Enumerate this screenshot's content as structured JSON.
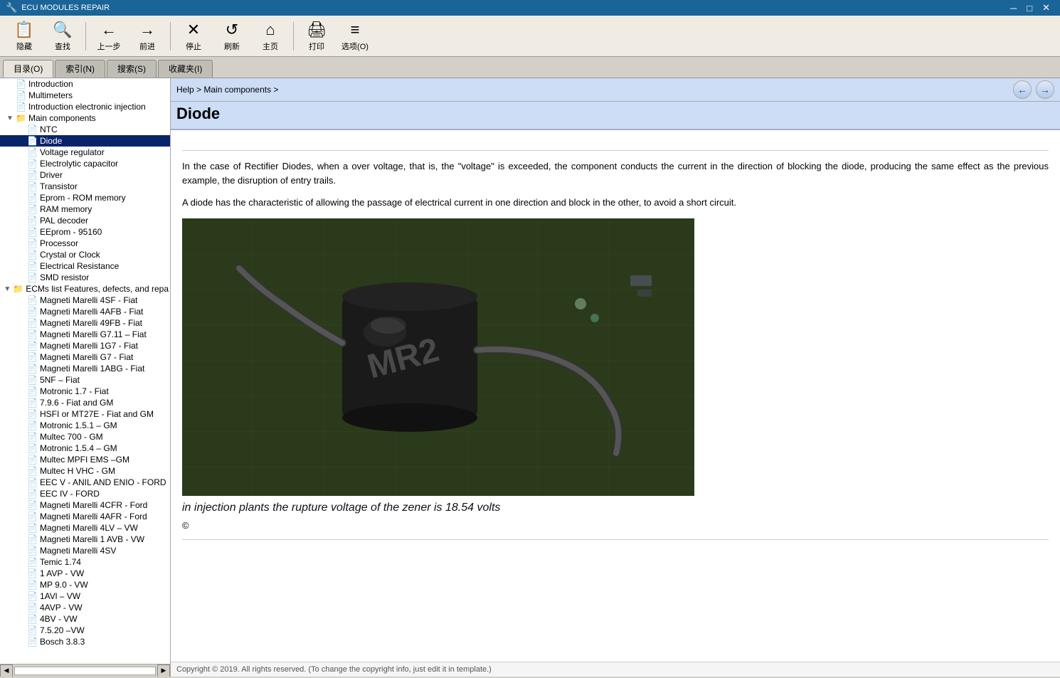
{
  "window": {
    "title": "ECU MODULES REPAIR",
    "icon": "🔧"
  },
  "titlebar_controls": {
    "minimize": "─",
    "maximize": "□",
    "close": "✕"
  },
  "toolbar": {
    "buttons": [
      {
        "id": "hide",
        "icon": "📋",
        "label": "隐藏"
      },
      {
        "id": "search",
        "icon": "🔍",
        "label": "查找"
      },
      {
        "id": "back",
        "icon": "←",
        "label": "上一步"
      },
      {
        "id": "forward",
        "icon": "→",
        "label": "前进"
      },
      {
        "id": "stop",
        "icon": "✕",
        "label": "停止"
      },
      {
        "id": "refresh",
        "icon": "↺",
        "label": "刷新"
      },
      {
        "id": "home",
        "icon": "⌂",
        "label": "主页"
      },
      {
        "id": "print",
        "icon": "🖨",
        "label": "打印"
      },
      {
        "id": "options",
        "icon": "≡",
        "label": "选项(O)"
      }
    ]
  },
  "nav_tabs": [
    {
      "id": "toc",
      "label": "目录(O)",
      "active": true
    },
    {
      "id": "index",
      "label": "索引(N)",
      "active": false
    },
    {
      "id": "search",
      "label": "搜索(S)",
      "active": false
    },
    {
      "id": "favorites",
      "label": "收藏夹(I)",
      "active": false
    }
  ],
  "sidebar": {
    "items": [
      {
        "id": "introduction",
        "label": "Introduction",
        "level": 0,
        "icon": "📄",
        "toggle": "",
        "type": "leaf"
      },
      {
        "id": "multimeters",
        "label": "Multimeters",
        "level": 0,
        "icon": "📄",
        "toggle": "",
        "type": "leaf"
      },
      {
        "id": "intro-electronic",
        "label": "Introduction electronic injection",
        "level": 0,
        "icon": "📄",
        "toggle": "",
        "type": "leaf"
      },
      {
        "id": "main-components",
        "label": "Main components",
        "level": 0,
        "icon": "📁",
        "toggle": "▼",
        "type": "folder",
        "expanded": true
      },
      {
        "id": "ntc",
        "label": "NTC",
        "level": 1,
        "icon": "📄",
        "toggle": "",
        "type": "leaf"
      },
      {
        "id": "diode",
        "label": "Diode",
        "level": 1,
        "icon": "📄",
        "toggle": "",
        "type": "leaf",
        "selected": true
      },
      {
        "id": "voltage-regulator",
        "label": "Voltage regulator",
        "level": 1,
        "icon": "📄",
        "toggle": "",
        "type": "leaf"
      },
      {
        "id": "electrolytic-cap",
        "label": "Electrolytic capacitor",
        "level": 1,
        "icon": "📄",
        "toggle": "",
        "type": "leaf"
      },
      {
        "id": "driver",
        "label": "Driver",
        "level": 1,
        "icon": "📄",
        "toggle": "",
        "type": "leaf"
      },
      {
        "id": "transistor",
        "label": "Transistor",
        "level": 1,
        "icon": "📄",
        "toggle": "",
        "type": "leaf"
      },
      {
        "id": "eprom-rom",
        "label": "Eprom - ROM memory",
        "level": 1,
        "icon": "📄",
        "toggle": "",
        "type": "leaf"
      },
      {
        "id": "ram-memory",
        "label": "RAM memory",
        "level": 1,
        "icon": "📄",
        "toggle": "",
        "type": "leaf"
      },
      {
        "id": "pal-decoder",
        "label": "PAL decoder",
        "level": 1,
        "icon": "📄",
        "toggle": "",
        "type": "leaf"
      },
      {
        "id": "eeprom-95160",
        "label": "EEprom - 95160",
        "level": 1,
        "icon": "📄",
        "toggle": "",
        "type": "leaf"
      },
      {
        "id": "processor",
        "label": "Processor",
        "level": 1,
        "icon": "📄",
        "toggle": "",
        "type": "leaf"
      },
      {
        "id": "crystal-clock",
        "label": "Crystal or Clock",
        "level": 1,
        "icon": "📄",
        "toggle": "",
        "type": "leaf"
      },
      {
        "id": "electrical-resistance",
        "label": "Electrical Resistance",
        "level": 1,
        "icon": "📄",
        "toggle": "",
        "type": "leaf"
      },
      {
        "id": "smd-resistor",
        "label": "SMD resistor",
        "level": 1,
        "icon": "📄",
        "toggle": "",
        "type": "leaf"
      },
      {
        "id": "ecms-list",
        "label": "ECMs list Features, defects, and repa",
        "level": 0,
        "icon": "📁",
        "toggle": "▼",
        "type": "folder",
        "expanded": true
      },
      {
        "id": "magneti-4sf",
        "label": "Magneti Marelli 4SF - Fiat",
        "level": 1,
        "icon": "📄",
        "toggle": "",
        "type": "leaf"
      },
      {
        "id": "magneti-4afb",
        "label": "Magneti Marelli 4AFB - Fiat",
        "level": 1,
        "icon": "📄",
        "toggle": "",
        "type": "leaf"
      },
      {
        "id": "magneti-49fb",
        "label": "Magneti Marelli 49FB - Fiat",
        "level": 1,
        "icon": "📄",
        "toggle": "",
        "type": "leaf"
      },
      {
        "id": "magneti-g711",
        "label": "Magneti Marelli G7.11 – Fiat",
        "level": 1,
        "icon": "📄",
        "toggle": "",
        "type": "leaf"
      },
      {
        "id": "magneti-1g7",
        "label": "Magneti Marelli 1G7 - Fiat",
        "level": 1,
        "icon": "📄",
        "toggle": "",
        "type": "leaf"
      },
      {
        "id": "magneti-g7",
        "label": "Magneti Marelli G7 - Fiat",
        "level": 1,
        "icon": "📄",
        "toggle": "",
        "type": "leaf"
      },
      {
        "id": "magneti-1abg",
        "label": "Magneti Marelli 1ABG - Fiat",
        "level": 1,
        "icon": "📄",
        "toggle": "",
        "type": "leaf"
      },
      {
        "id": "5nf-fiat",
        "label": "5NF – Fiat",
        "level": 1,
        "icon": "📄",
        "toggle": "",
        "type": "leaf"
      },
      {
        "id": "motronic-17",
        "label": "Motronic 1.7 - Fiat",
        "level": 1,
        "icon": "📄",
        "toggle": "",
        "type": "leaf"
      },
      {
        "id": "motronic-796",
        "label": "7.9.6 - Fiat and GM",
        "level": 1,
        "icon": "📄",
        "toggle": "",
        "type": "leaf"
      },
      {
        "id": "hsfi",
        "label": "HSFI or MT27E - Fiat and GM",
        "level": 1,
        "icon": "📄",
        "toggle": "",
        "type": "leaf"
      },
      {
        "id": "motronic-151",
        "label": "Motronic 1.5.1 – GM",
        "level": 1,
        "icon": "📄",
        "toggle": "",
        "type": "leaf"
      },
      {
        "id": "multec-700",
        "label": "Multec 700 - GM",
        "level": 1,
        "icon": "📄",
        "toggle": "",
        "type": "leaf"
      },
      {
        "id": "motronic-154",
        "label": "Motronic 1.5.4 – GM",
        "level": 1,
        "icon": "📄",
        "toggle": "",
        "type": "leaf"
      },
      {
        "id": "multec-mpfi",
        "label": "Multec MPFI EMS –GM",
        "level": 1,
        "icon": "📄",
        "toggle": "",
        "type": "leaf"
      },
      {
        "id": "multec-hvhc",
        "label": "Multec H VHC - GM",
        "level": 1,
        "icon": "📄",
        "toggle": "",
        "type": "leaf"
      },
      {
        "id": "eec-v",
        "label": "EEC V - ANIL AND ENIO - FORD",
        "level": 1,
        "icon": "📄",
        "toggle": "",
        "type": "leaf"
      },
      {
        "id": "eec-iv",
        "label": "EEC IV - FORD",
        "level": 1,
        "icon": "📄",
        "toggle": "",
        "type": "leaf"
      },
      {
        "id": "magneti-4cfr",
        "label": "Magneti Marelli 4CFR - Ford",
        "level": 1,
        "icon": "📄",
        "toggle": "",
        "type": "leaf"
      },
      {
        "id": "magneti-4afr",
        "label": "Magneti Marelli 4AFR - Ford",
        "level": 1,
        "icon": "📄",
        "toggle": "",
        "type": "leaf"
      },
      {
        "id": "magneti-4lv",
        "label": "Magneti Marelli 4LV – VW",
        "level": 1,
        "icon": "📄",
        "toggle": "",
        "type": "leaf"
      },
      {
        "id": "magneti-1avb",
        "label": "Magneti Marelli 1 AVB - VW",
        "level": 1,
        "icon": "📄",
        "toggle": "",
        "type": "leaf"
      },
      {
        "id": "magneti-4sv",
        "label": "Magneti Marelli 4SV",
        "level": 1,
        "icon": "📄",
        "toggle": "",
        "type": "leaf"
      },
      {
        "id": "temic-174",
        "label": "Temic 1.74",
        "level": 1,
        "icon": "📄",
        "toggle": "",
        "type": "leaf"
      },
      {
        "id": "avp-1",
        "label": "1 AVP - VW",
        "level": 1,
        "icon": "📄",
        "toggle": "",
        "type": "leaf"
      },
      {
        "id": "mp90-vw",
        "label": "MP 9.0 - VW",
        "level": 1,
        "icon": "📄",
        "toggle": "",
        "type": "leaf"
      },
      {
        "id": "1avl-vw",
        "label": "1AVl – VW",
        "level": 1,
        "icon": "📄",
        "toggle": "",
        "type": "leaf"
      },
      {
        "id": "4avp-vw",
        "label": "4AVP - VW",
        "level": 1,
        "icon": "📄",
        "toggle": "",
        "type": "leaf"
      },
      {
        "id": "4bv-vw",
        "label": "4BV - VW",
        "level": 1,
        "icon": "📄",
        "toggle": "",
        "type": "leaf"
      },
      {
        "id": "7520-vw",
        "label": "7.5.20 –VW",
        "level": 1,
        "icon": "📄",
        "toggle": "",
        "type": "leaf"
      },
      {
        "id": "bosch-383",
        "label": "Bosch 3.8.3",
        "level": 1,
        "icon": "📄",
        "toggle": "",
        "type": "leaf"
      }
    ]
  },
  "breadcrumb": {
    "text": "Help > Main components >"
  },
  "page": {
    "title": "Diode",
    "content_p1": "In the case of Rectifier Diodes, when a over voltage, that is, the \"voltage\" is exceeded, the component conducts the current in the direction of blocking the diode, producing the same effect as the previous example, the disruption of entry trails.",
    "content_p2": "A diode has the characteristic of allowing the passage of electrical current in one direction and block in the other, to avoid a short circuit.",
    "caption": "in injection plants the rupture voltage of the zener is 18.54 volts",
    "copyright": "©",
    "footer_copyright": "Copyright © 2019. All rights reserved. (To change the copyright info, just edit it in template.)"
  }
}
